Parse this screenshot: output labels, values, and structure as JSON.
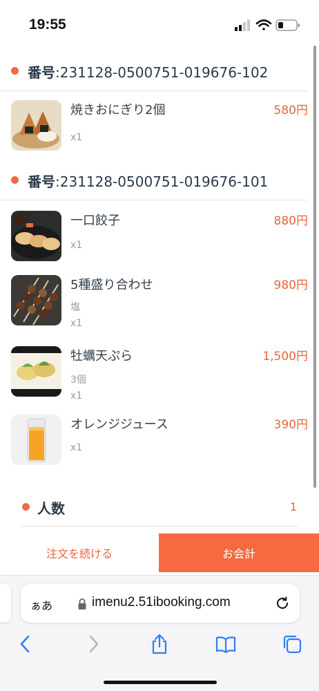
{
  "status_bar": {
    "time": "19:55"
  },
  "orders": [
    {
      "label_prefix": "番号",
      "number": ":231128-0500751-019676-102",
      "items": [
        {
          "name": "焼きおにぎり2個",
          "price": "580円",
          "qty": "x1",
          "image": "onigiri-image"
        }
      ]
    },
    {
      "label_prefix": "番号",
      "number": ":231128-0500751-019676-101",
      "items": [
        {
          "name": "一口餃子",
          "price": "880円",
          "qty": "x1",
          "image": "gyoza-image"
        },
        {
          "name": "5種盛り合わせ",
          "price": "980円",
          "option": "塩",
          "qty": "x1",
          "image": "yakitori-image"
        },
        {
          "name": "牡蠣天ぷら",
          "price": "1,500円",
          "option": "3個",
          "qty": "x1",
          "image": "tempura-image"
        },
        {
          "name": "オレンジジュース",
          "price": "390円",
          "qty": "x1",
          "image": "orange-juice-image"
        }
      ]
    }
  ],
  "people": {
    "label": "人数",
    "count": "1"
  },
  "buttons": {
    "continue": "注文を続ける",
    "checkout": "お会計"
  },
  "browser": {
    "aa": "ぁあ",
    "url": "imenu2.51ibooking.com"
  },
  "colors": {
    "accent": "#f56a40",
    "price": "#e9653d",
    "ios_blue": "#2f7cf6"
  }
}
